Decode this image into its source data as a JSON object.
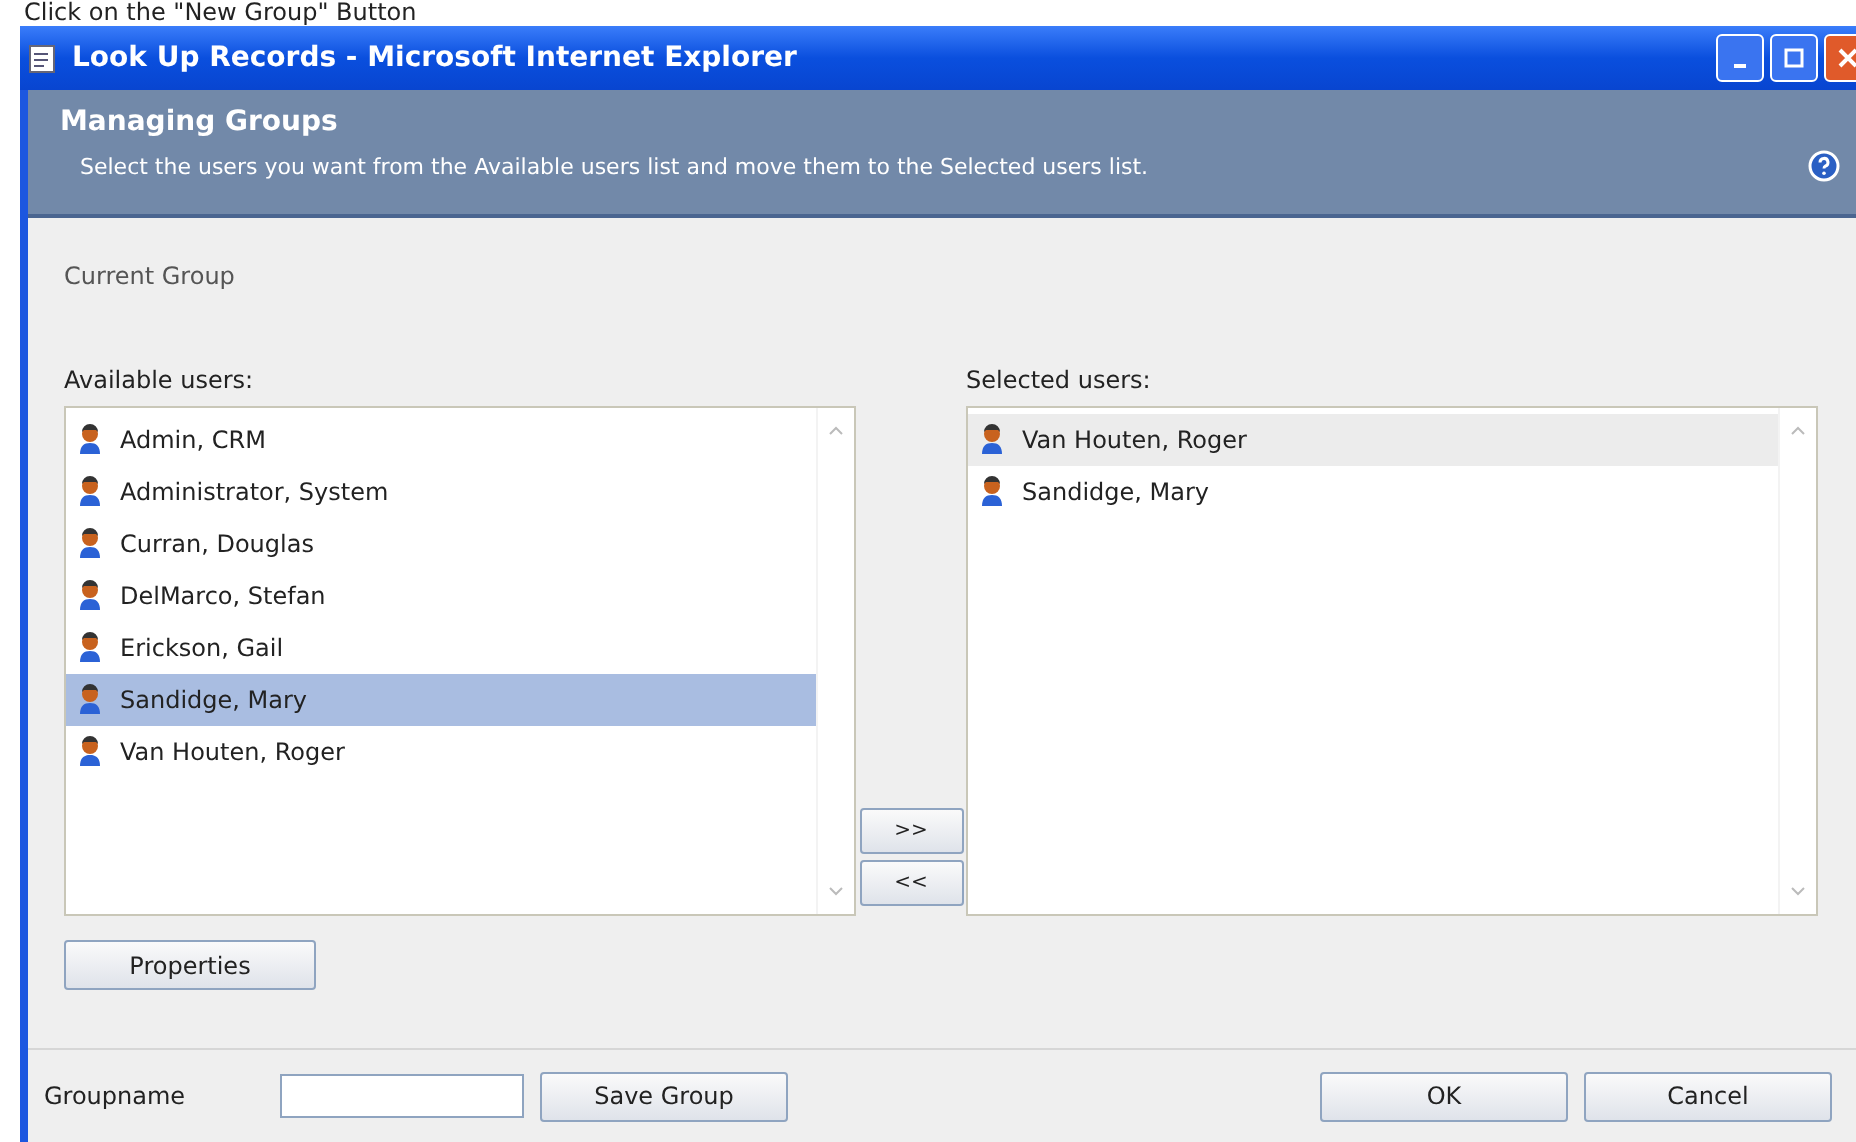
{
  "caption": "Click on the \"New Group\" Button",
  "window": {
    "title": "Look Up Records - Microsoft Internet Explorer"
  },
  "header": {
    "title": "Managing Groups",
    "description": "Select the users you want from the Available users list and move them to the Selected users list."
  },
  "current_group_label": "Current Group",
  "available": {
    "label": "Available users:",
    "focused": true,
    "items": [
      {
        "name": "Admin, CRM",
        "selected": false
      },
      {
        "name": "Administrator, System",
        "selected": false
      },
      {
        "name": "Curran, Douglas",
        "selected": false
      },
      {
        "name": "DelMarco, Stefan",
        "selected": false
      },
      {
        "name": "Erickson, Gail",
        "selected": false
      },
      {
        "name": "Sandidge, Mary",
        "selected": true
      },
      {
        "name": "Van Houten, Roger",
        "selected": false
      }
    ]
  },
  "move_buttons": [
    ">>",
    "<<"
  ],
  "selected_list": {
    "label": "Selected users:",
    "focused": false,
    "items": [
      {
        "name": "Van Houten, Roger",
        "selected": true
      },
      {
        "name": "Sandidge, Mary",
        "selected": false
      }
    ]
  },
  "properties_button": "Properties",
  "footer": {
    "groupname_label": "Groupname",
    "save_button": "Save Group",
    "ok_button": "OK",
    "cancel_button": "Cancel"
  }
}
